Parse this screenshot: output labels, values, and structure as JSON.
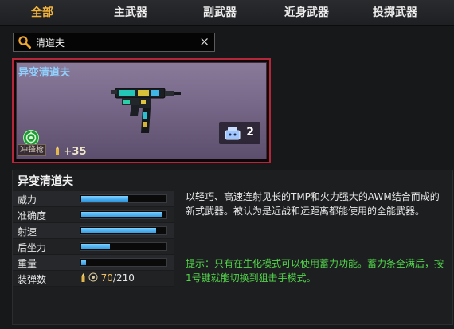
{
  "tabs": [
    {
      "label": "全部",
      "active": true
    },
    {
      "label": "主武器",
      "active": false
    },
    {
      "label": "副武器",
      "active": false
    },
    {
      "label": "近身武器",
      "active": false
    },
    {
      "label": "投掷武器",
      "active": false
    }
  ],
  "search": {
    "value": "清道夫",
    "clear_symbol": "×"
  },
  "card": {
    "name": "异变清道夫",
    "category_tag": "冲锋枪",
    "bonus": "+35",
    "count": "2",
    "accent": "#b4273b"
  },
  "detail": {
    "title": "异变清道夫",
    "stats": [
      {
        "label": "威力",
        "value": 0.56
      },
      {
        "label": "准确度",
        "value": 0.95
      },
      {
        "label": "射速",
        "value": 0.89
      },
      {
        "label": "后坐力",
        "value": 0.34
      },
      {
        "label": "重量",
        "value": 0.06
      }
    ],
    "ammo_label": "装弹数",
    "ammo_current": "70",
    "ammo_total": "/210",
    "description": "以轻巧、高速连射见长的TMP和火力强大的AWM结合而成的新式武器。被认为是近战和远距离都能使用的全能武器。",
    "tip": "提示：只有在生化模式可以使用蓄力功能。蓄力条全满后，按1号键就能切换到狙击手模式。"
  },
  "colors": {
    "tab_active": "#f2b43a",
    "tip_text": "#52d44a",
    "card_name": "#8fd2ff",
    "bar": "#2b95e0"
  }
}
